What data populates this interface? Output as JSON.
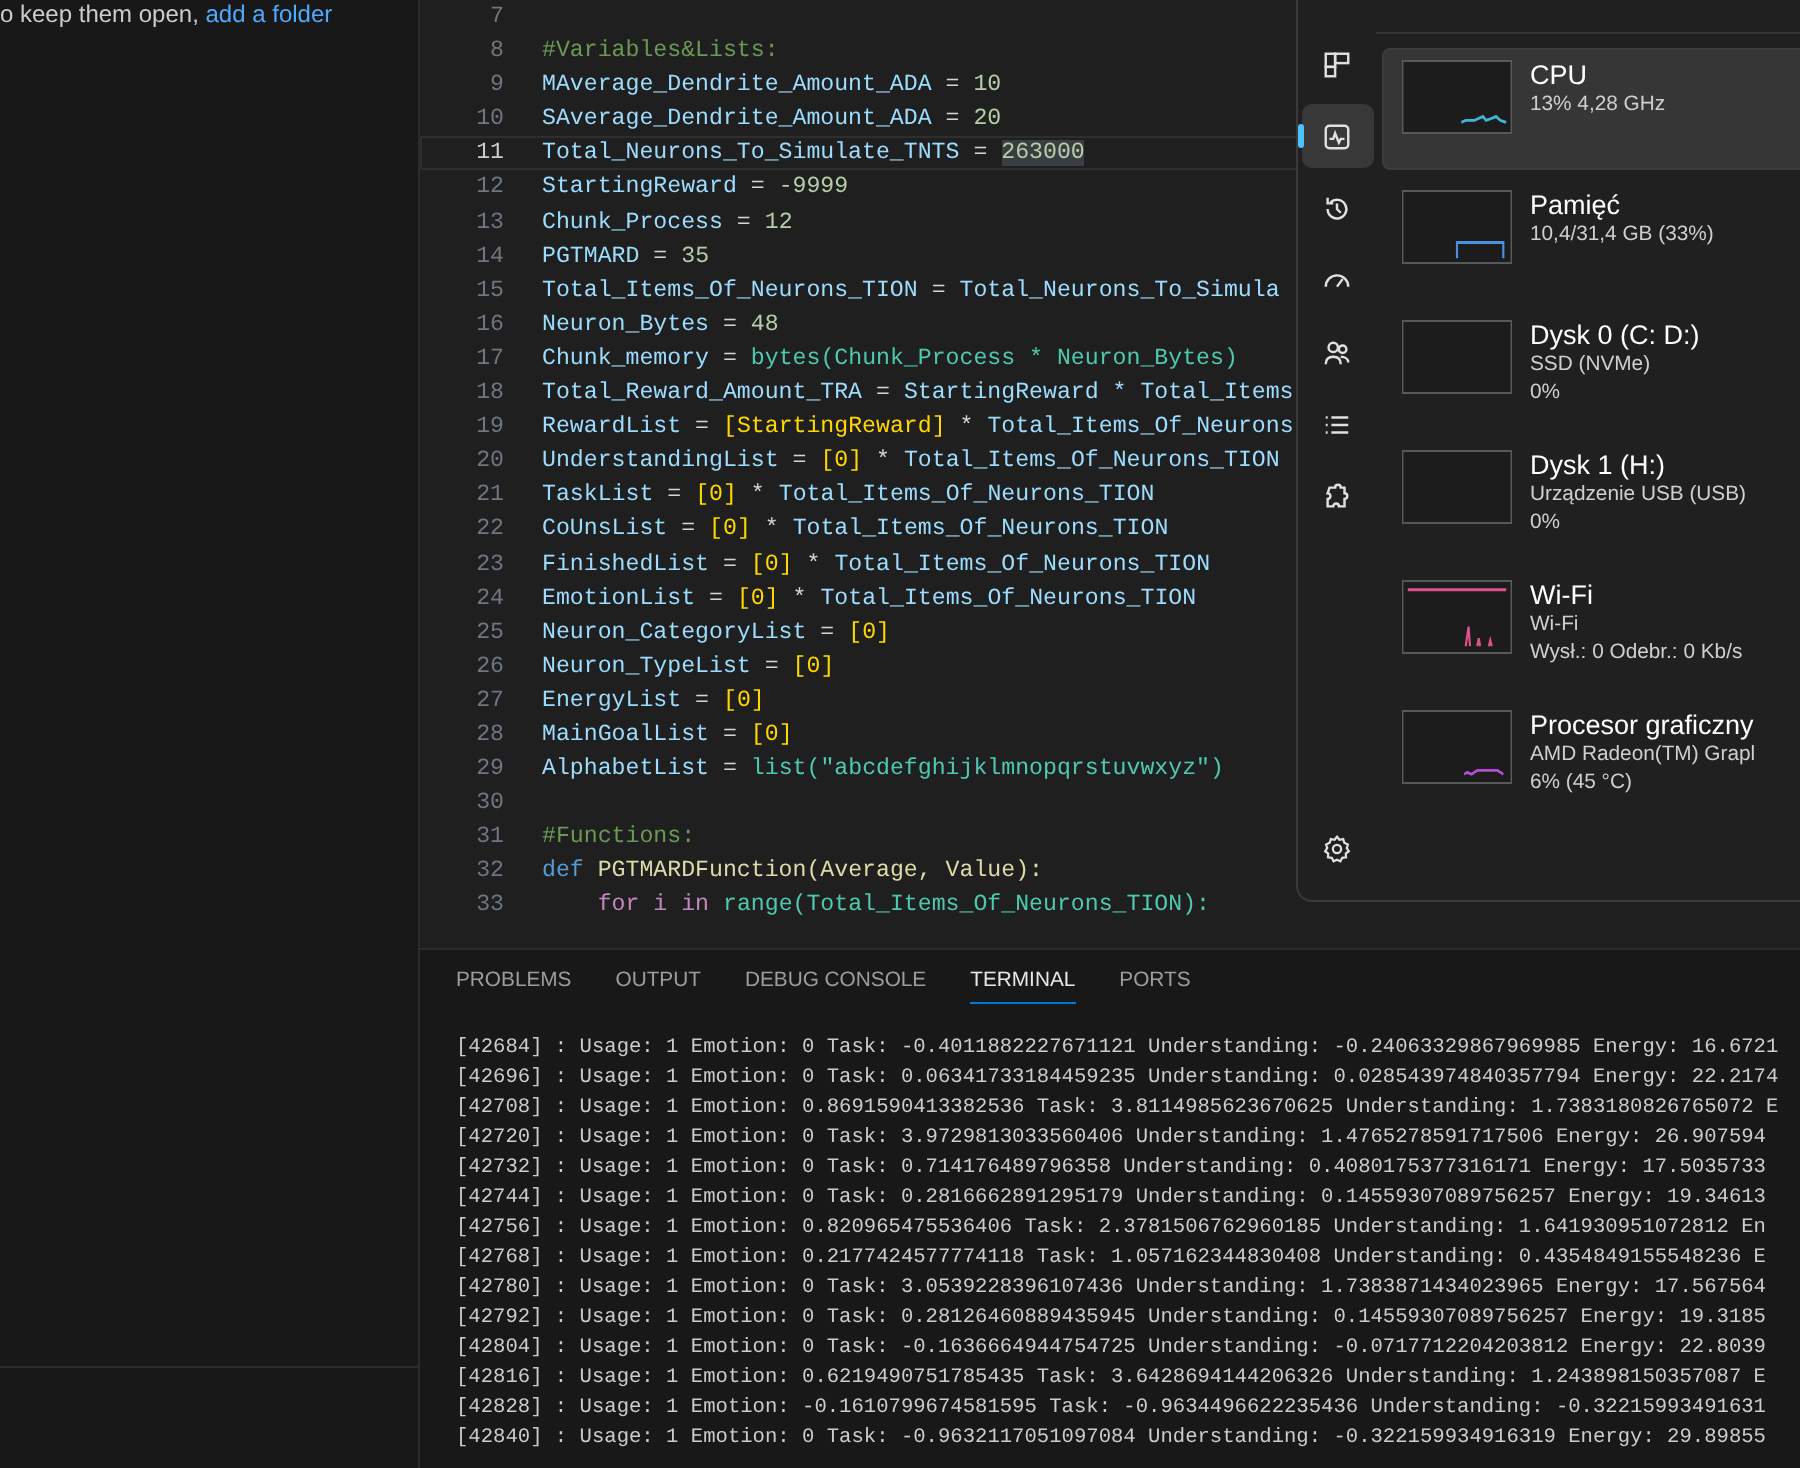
{
  "explorer": {
    "hint": "o keep them open, ",
    "link": "add a folder"
  },
  "editor": {
    "lines": [
      {
        "number": "7",
        "current": false
      },
      {
        "number": "8",
        "current": false,
        "tokens": [
          {
            "kind": "comment",
            "text": "#Variables&Lists:"
          }
        ]
      },
      {
        "number": "9",
        "current": false,
        "tokens": [
          {
            "kind": "var",
            "text": "MAverage_Dendrite_Amount_ADA"
          },
          {
            "kind": "op",
            "text": "="
          },
          {
            "kind": "num",
            "text": "10"
          }
        ]
      },
      {
        "number": "10",
        "current": false,
        "tokens": [
          {
            "kind": "var",
            "text": "SAverage_Dendrite_Amount_ADA"
          },
          {
            "kind": "op",
            "text": "="
          },
          {
            "kind": "num",
            "text": "20"
          }
        ]
      },
      {
        "number": "11",
        "current": true,
        "tokens": [
          {
            "kind": "var",
            "text": "Total_Neurons_To_Simulate_TNTS"
          },
          {
            "kind": "op",
            "text": "="
          },
          {
            "kind": "sel",
            "text": "263000"
          }
        ]
      },
      {
        "number": "12",
        "current": false,
        "tokens": [
          {
            "kind": "var",
            "text": "StartingReward"
          },
          {
            "kind": "op",
            "text": "="
          },
          {
            "kind": "num",
            "text": "-9999"
          }
        ]
      },
      {
        "number": "13",
        "current": false,
        "tokens": [
          {
            "kind": "var",
            "text": "Chunk_Process"
          },
          {
            "kind": "op",
            "text": "="
          },
          {
            "kind": "num",
            "text": "12"
          }
        ]
      },
      {
        "number": "14",
        "current": false,
        "tokens": [
          {
            "kind": "var",
            "text": "PGTMARD"
          },
          {
            "kind": "op",
            "text": "="
          },
          {
            "kind": "num",
            "text": "35"
          }
        ]
      },
      {
        "number": "15",
        "current": false,
        "tokens": [
          {
            "kind": "var",
            "text": "Total_Items_Of_Neurons_TION"
          },
          {
            "kind": "op",
            "text": "="
          },
          {
            "kind": "var",
            "text": "Total_Neurons_To_Simula"
          }
        ]
      },
      {
        "number": "16",
        "current": false,
        "tokens": [
          {
            "kind": "var",
            "text": "Neuron_Bytes"
          },
          {
            "kind": "op",
            "text": "="
          },
          {
            "kind": "num",
            "text": "48"
          }
        ]
      },
      {
        "number": "17",
        "current": false,
        "tokens": [
          {
            "kind": "var",
            "text": "Chunk_memory"
          },
          {
            "kind": "op",
            "text": "="
          },
          {
            "kind": "call",
            "text": "bytes(Chunk_Process * Neuron_Bytes)"
          }
        ]
      },
      {
        "number": "18",
        "current": false,
        "tokens": [
          {
            "kind": "var",
            "text": "Total_Reward_Amount_TRA"
          },
          {
            "kind": "op",
            "text": "="
          },
          {
            "kind": "var",
            "text": "StartingReward * Total_Items"
          }
        ]
      },
      {
        "number": "19",
        "current": false,
        "tokens": [
          {
            "kind": "var",
            "text": "RewardList"
          },
          {
            "kind": "op",
            "text": "="
          },
          {
            "kind": "bracket",
            "text": "[StartingReward]"
          },
          {
            "kind": "op",
            "text": "*"
          },
          {
            "kind": "var",
            "text": "Total_Items_Of_Neurons"
          }
        ]
      },
      {
        "number": "20",
        "current": false,
        "tokens": [
          {
            "kind": "var",
            "text": "UnderstandingList"
          },
          {
            "kind": "op",
            "text": "="
          },
          {
            "kind": "bracket",
            "text": "[0]"
          },
          {
            "kind": "op",
            "text": "*"
          },
          {
            "kind": "var",
            "text": "Total_Items_Of_Neurons_TION"
          }
        ]
      },
      {
        "number": "21",
        "current": false,
        "tokens": [
          {
            "kind": "var",
            "text": "TaskList"
          },
          {
            "kind": "op",
            "text": "="
          },
          {
            "kind": "bracket",
            "text": "[0]"
          },
          {
            "kind": "op",
            "text": "*"
          },
          {
            "kind": "var",
            "text": "Total_Items_Of_Neurons_TION"
          }
        ]
      },
      {
        "number": "22",
        "current": false,
        "tokens": [
          {
            "kind": "var",
            "text": "CoUnsList"
          },
          {
            "kind": "op",
            "text": "="
          },
          {
            "kind": "bracket",
            "text": "[0]"
          },
          {
            "kind": "op",
            "text": "*"
          },
          {
            "kind": "var",
            "text": "Total_Items_Of_Neurons_TION"
          }
        ]
      },
      {
        "number": "23",
        "current": false,
        "tokens": [
          {
            "kind": "var",
            "text": "FinishedList"
          },
          {
            "kind": "op",
            "text": "="
          },
          {
            "kind": "bracket",
            "text": "[0]"
          },
          {
            "kind": "op",
            "text": "*"
          },
          {
            "kind": "var",
            "text": "Total_Items_Of_Neurons_TION"
          }
        ]
      },
      {
        "number": "24",
        "current": false,
        "tokens": [
          {
            "kind": "var",
            "text": "EmotionList"
          },
          {
            "kind": "op",
            "text": "="
          },
          {
            "kind": "bracket",
            "text": "[0]"
          },
          {
            "kind": "op",
            "text": "*"
          },
          {
            "kind": "var",
            "text": "Total_Items_Of_Neurons_TION"
          }
        ]
      },
      {
        "number": "25",
        "current": false,
        "tokens": [
          {
            "kind": "var",
            "text": "Neuron_CategoryList"
          },
          {
            "kind": "op",
            "text": "="
          },
          {
            "kind": "bracket",
            "text": "[0]"
          }
        ]
      },
      {
        "number": "26",
        "current": false,
        "tokens": [
          {
            "kind": "var",
            "text": "Neuron_TypeList"
          },
          {
            "kind": "op",
            "text": "="
          },
          {
            "kind": "bracket",
            "text": "[0]"
          }
        ]
      },
      {
        "number": "27",
        "current": false,
        "tokens": [
          {
            "kind": "var",
            "text": "EnergyList"
          },
          {
            "kind": "op",
            "text": "="
          },
          {
            "kind": "bracket",
            "text": "[0]"
          }
        ]
      },
      {
        "number": "28",
        "current": false,
        "tokens": [
          {
            "kind": "var",
            "text": "MainGoalList"
          },
          {
            "kind": "op",
            "text": "="
          },
          {
            "kind": "bracket",
            "text": "[0]"
          }
        ]
      },
      {
        "number": "29",
        "current": false,
        "tokens": [
          {
            "kind": "var",
            "text": "AlphabetList"
          },
          {
            "kind": "op",
            "text": "="
          },
          {
            "kind": "call",
            "text": "list(\"abcdefghijklmnopqrstuvwxyz\")"
          }
        ]
      },
      {
        "number": "30",
        "current": false
      },
      {
        "number": "31",
        "current": false,
        "tokens": [
          {
            "kind": "comment",
            "text": "#Functions:"
          }
        ]
      },
      {
        "number": "32",
        "current": false,
        "tokens": [
          {
            "kind": "keyword",
            "text": "def"
          },
          {
            "kind": "func",
            "text": "PGTMARDFunction(Average, Value):"
          }
        ]
      },
      {
        "number": "33",
        "current": false,
        "tokens": [
          {
            "kind": "control",
            "text": "for i in"
          },
          {
            "kind": "call",
            "text": "range(Total_Items_Of_Neurons_TION):"
          }
        ]
      }
    ]
  },
  "task_manager": {
    "nav": [
      {
        "kind": "grid",
        "selected": false
      },
      {
        "kind": "pulse",
        "selected": true
      },
      {
        "kind": "history",
        "selected": false
      },
      {
        "kind": "gauge",
        "selected": false
      },
      {
        "kind": "users",
        "selected": false
      },
      {
        "kind": "list",
        "selected": false
      },
      {
        "kind": "puzzle",
        "selected": false
      }
    ],
    "items": [
      {
        "title": "CPU",
        "lines": [
          "13% 4,28 GHz"
        ],
        "color": "#3fb5d8",
        "selected": true
      },
      {
        "title": "Pamięć",
        "lines": [
          "10,4/31,4 GB (33%)"
        ],
        "color": "#4a8fe0",
        "selected": false
      },
      {
        "title": "Dysk 0 (C: D:)",
        "lines": [
          "SSD (NVMe)",
          "0%"
        ],
        "selected": false
      },
      {
        "title": "Dysk 1 (H:)",
        "lines": [
          "Urządzenie USB (USB)",
          "0%"
        ],
        "selected": false
      },
      {
        "title": "Wi-Fi",
        "lines": [
          "Wi-Fi",
          "Wysł.: 0 Odebr.: 0 Kb/s"
        ],
        "color": "#e0508a",
        "selected": false
      },
      {
        "title": "Procesor graficzny",
        "lines": [
          "AMD Radeon(TM) Grapl",
          "6% (45 °C)"
        ],
        "color": "#b34fd6",
        "selected": false
      }
    ]
  },
  "panel": {
    "tabs": [
      {
        "label": "PROBLEMS",
        "selected": false
      },
      {
        "label": "OUTPUT",
        "selected": false
      },
      {
        "label": "DEBUG CONSOLE",
        "selected": false
      },
      {
        "label": "TERMINAL",
        "selected": true
      },
      {
        "label": "PORTS",
        "selected": false
      }
    ],
    "terminal": [
      "[42684] : Usage: 1 Emotion: 0 Task: -0.4011882227671121 Understanding: -0.24063329867969985 Energy: 16.6721",
      "[42696] : Usage: 1 Emotion: 0 Task: 0.06341733184459235 Understanding: 0.028543974840357794 Energy: 22.2174",
      "[42708] : Usage: 1 Emotion: 0.8691590413382536 Task: 3.8114985623670625 Understanding: 1.7383180826765072 E",
      "[42720] : Usage: 1 Emotion: 0 Task: 3.9729813033560406 Understanding: 1.4765278591717506 Energy: 26.907594",
      "[42732] : Usage: 1 Emotion: 0 Task: 0.714176489796358 Understanding: 0.4080175377316171 Energy: 17.5035733",
      "[42744] : Usage: 1 Emotion: 0 Task: 0.2816662891295179 Understanding: 0.14559307089756257 Energy: 19.34613",
      "[42756] : Usage: 1 Emotion: 0.820965475536406 Task: 2.3781506762960185 Understanding: 1.641930951072812 En",
      "[42768] : Usage: 1 Emotion: 0.2177424577774118 Task: 1.057162344830408 Understanding: 0.4354849155548236 E",
      "[42780] : Usage: 1 Emotion: 0 Task: 3.0539228396107436 Understanding: 1.7383871434023965 Energy: 17.567564",
      "[42792] : Usage: 1 Emotion: 0 Task: 0.28126460889435945 Understanding: 0.14559307089756257 Energy: 19.3185",
      "[42804] : Usage: 1 Emotion: 0 Task: -0.1636664944754725 Understanding: -0.0717712204203812 Energy: 22.8039",
      "[42816] : Usage: 1 Emotion: 0.6219490751785435 Task: 3.6428694144206326 Understanding: 1.243898150357087 E",
      "[42828] : Usage: 1 Emotion: -0.1610799674581595 Task: -0.9634496622235436 Understanding: -0.32215993491631",
      "[42840] : Usage: 1 Emotion: 0 Task: -0.9632117051097084 Understanding: -0.322159934916319 Energy: 29.89855"
    ]
  }
}
